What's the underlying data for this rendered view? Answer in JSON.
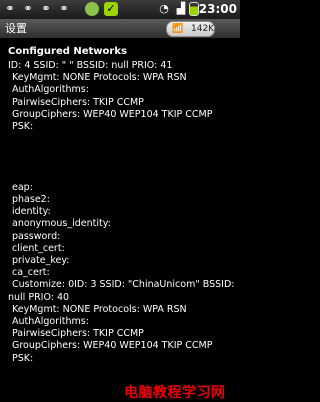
{
  "statusbar": {
    "icons": [
      "usb",
      "usb",
      "usb",
      "usb",
      "android",
      "update",
      "wifi",
      "signal",
      "battery"
    ],
    "time": "23:00"
  },
  "titlebar": {
    "title": "设置",
    "traffic_rate": "142K",
    "traffic_icon": "wifi-icon"
  },
  "content": {
    "heading": "Configured Networks",
    "lines": [
      "ID: 4 SSID: \"       \" BSSID: null PRIO: 41",
      "KeyMgmt: NONE Protocols: WPA RSN",
      "AuthAlgorithms:",
      "PairwiseCiphers: TKIP CCMP",
      "GroupCiphers: WEP40 WEP104 TKIP CCMP",
      "PSK:",
      "",
      "",
      "",
      "",
      "eap:",
      "phase2:",
      "identity:",
      "anonymous_identity:",
      "password:",
      "client_cert:",
      "private_key:",
      "ca_cert:",
      "Customize: 0ID: 3 SSID: \"ChinaUnicom\" BSSID:",
      "null PRIO: 40",
      "KeyMgmt: NONE Protocols: WPA RSN",
      "AuthAlgorithms:",
      "PairwiseCiphers: TKIP CCMP",
      "GroupCiphers: WEP40 WEP104 TKIP CCMP",
      "PSK:"
    ]
  },
  "watermark": "电脑教程学习网",
  "colors": {
    "background": "#000000",
    "text": "#ffffff",
    "watermark": "#e8000a"
  }
}
